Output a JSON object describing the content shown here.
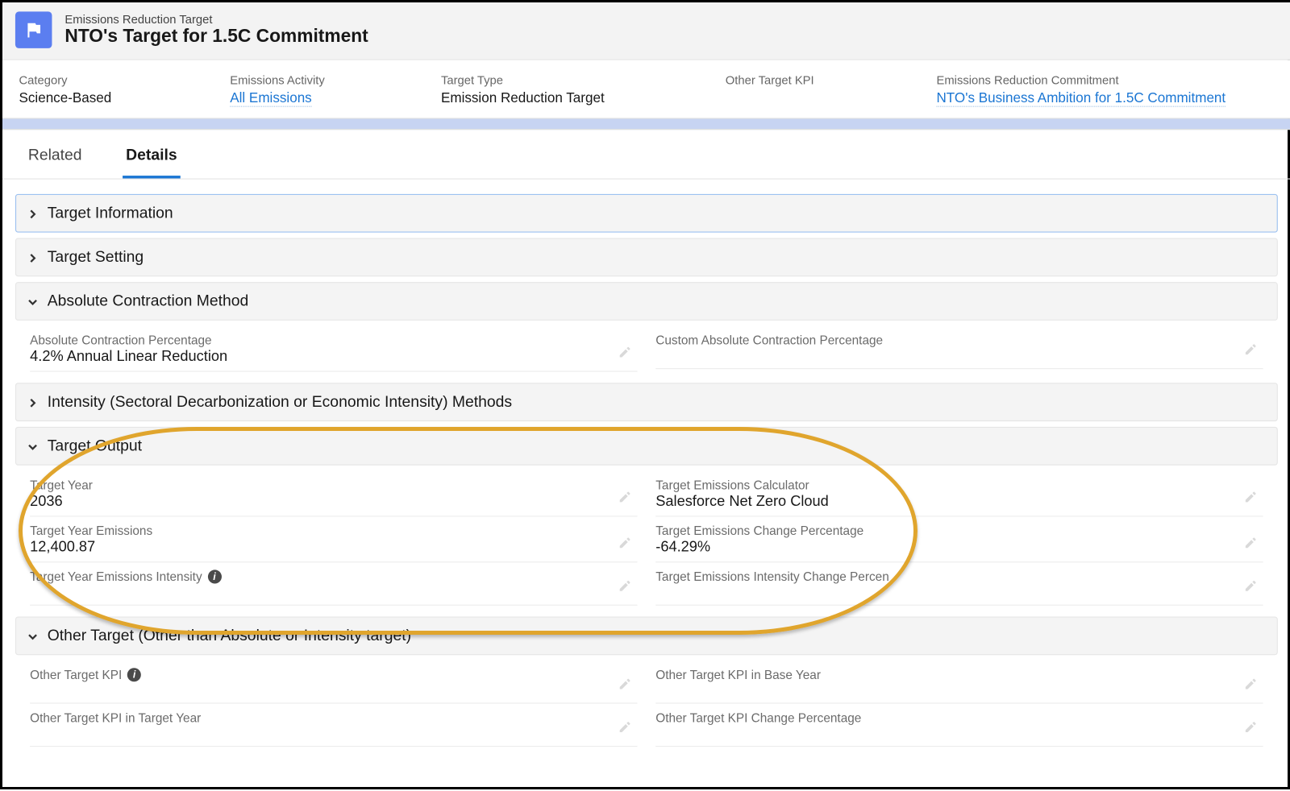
{
  "header": {
    "object_label": "Emissions Reduction Target",
    "title": "NTO's Target for 1.5C Commitment"
  },
  "summary": {
    "category_label": "Category",
    "category_value": "Science-Based",
    "activity_label": "Emissions Activity",
    "activity_value": "All Emissions",
    "type_label": "Target Type",
    "type_value": "Emission Reduction Target",
    "other_kpi_label": "Other Target KPI",
    "other_kpi_value": "",
    "commitment_label": "Emissions Reduction Commitment",
    "commitment_value": "NTO's Business Ambition for 1.5C Commitment"
  },
  "tabs": {
    "related": "Related",
    "details": "Details"
  },
  "sections": {
    "target_info": "Target Information",
    "target_setting": "Target Setting",
    "abs_contraction": "Absolute Contraction Method",
    "intensity": "Intensity (Sectoral Decarbonization or Economic Intensity) Methods",
    "target_output": "Target Output",
    "other_target": "Other Target (Other than Absolute or Intensity target)"
  },
  "abs": {
    "pct_label": "Absolute Contraction Percentage",
    "pct_value": "4.2% Annual Linear Reduction",
    "custom_label": "Custom Absolute Contraction Percentage",
    "custom_value": ""
  },
  "output": {
    "year_label": "Target Year",
    "year_value": "2036",
    "calc_label": "Target Emissions Calculator",
    "calc_value": "Salesforce Net Zero Cloud",
    "emissions_label": "Target Year Emissions",
    "emissions_value": "12,400.87",
    "change_label": "Target Emissions Change Percentage",
    "change_value": "-64.29%",
    "intensity_label": "Target Year Emissions Intensity",
    "intensity_value": "",
    "intensity_change_label": "Target Emissions Intensity Change Percen",
    "intensity_change_value": ""
  },
  "other": {
    "kpi_label": "Other Target KPI",
    "kpi_value": "",
    "base_label": "Other Target KPI in Base Year",
    "base_value": "",
    "target_label": "Other Target KPI in Target Year",
    "target_value": "",
    "change_label": "Other Target KPI Change Percentage",
    "change_value": ""
  }
}
